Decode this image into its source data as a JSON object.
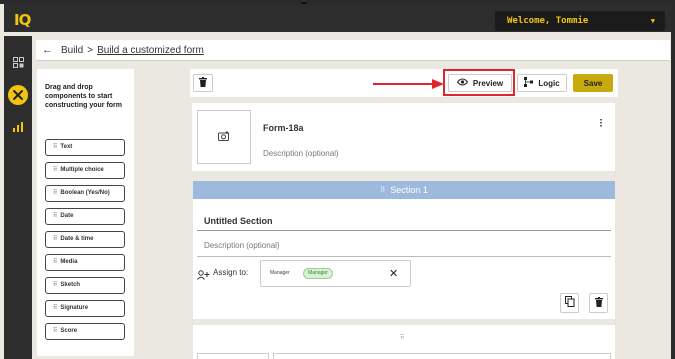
{
  "app": {
    "logo": "IQ",
    "welcome": "Welcome, Tommie"
  },
  "breadcrumb": {
    "parent": "Build",
    "separator": ">",
    "current": "Build a customized form"
  },
  "palette": {
    "title": "Drag and drop components to start constructing your form",
    "items": [
      "Text",
      "Multiple choice",
      "Boolean (Yes/No)",
      "Date",
      "Date & time",
      "Media",
      "Sketch",
      "Signature",
      "Score"
    ]
  },
  "toolbar": {
    "preview": "Preview",
    "logic": "Logic",
    "save": "Save"
  },
  "form": {
    "name": "Form-18a",
    "description_placeholder": "Description (optional)"
  },
  "section": {
    "header": "Section 1",
    "title": "Untitled Section",
    "description_placeholder": "Description (optional)",
    "assign_label": "Assign to:",
    "assign_value": "Manager",
    "assign_chip": "Manager"
  },
  "colors": {
    "accent": "#f1c40f",
    "save": "#c8a90e",
    "section_header": "#9db9db",
    "highlight": "#e0252b"
  },
  "icons": [
    "dashboard-icon",
    "tools-icon",
    "chart-icon",
    "back-arrow-icon",
    "trash-icon",
    "eye-icon",
    "logic-icon",
    "camera-add-icon",
    "more-vert-icon",
    "drag-handle-icon",
    "assign-user-icon",
    "close-icon",
    "copy-icon",
    "chevron-down-icon"
  ]
}
